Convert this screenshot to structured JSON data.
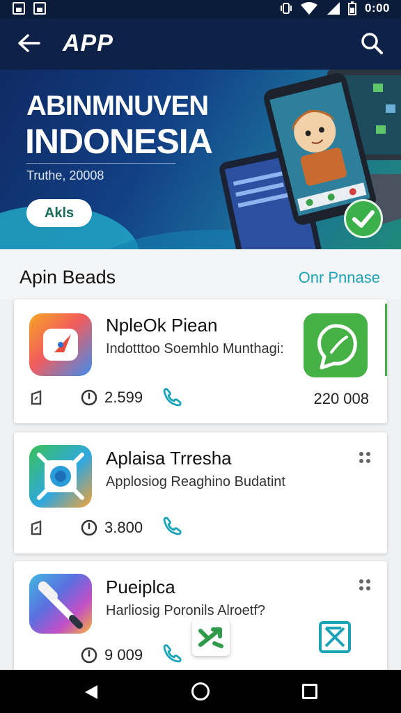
{
  "status_bar": {
    "time": "0:00"
  },
  "app_bar": {
    "title": "APP"
  },
  "banner": {
    "title_line1": "ABINMNUVEN",
    "title_line2": "INDONESIA",
    "subtitle": "Truthe, 20008",
    "button_label": "Akls"
  },
  "section": {
    "title": "Apin Beads",
    "link_label": "Onr Pnnase"
  },
  "apps": [
    {
      "title": "NpleOk Piean",
      "description": "Indotttoo Soemhlo Munthagi:",
      "count": "2.599",
      "size": "220 008"
    },
    {
      "title": "Aplaisa Trresha",
      "description": "Applosiog Reaghino Budatint",
      "count": "3.800"
    },
    {
      "title": "Pueiplca",
      "description": "Harliosig Poronils Alroetf?",
      "count": "9 009"
    }
  ],
  "colors": {
    "app_bar": "#0e2247",
    "accent": "#1ba3b8",
    "check_green": "#3cb04a"
  },
  "icons": [
    "back-arrow-icon",
    "search-icon",
    "clock-icon",
    "link-icon",
    "bookmark-icon",
    "more-icon",
    "checkmark-icon"
  ]
}
